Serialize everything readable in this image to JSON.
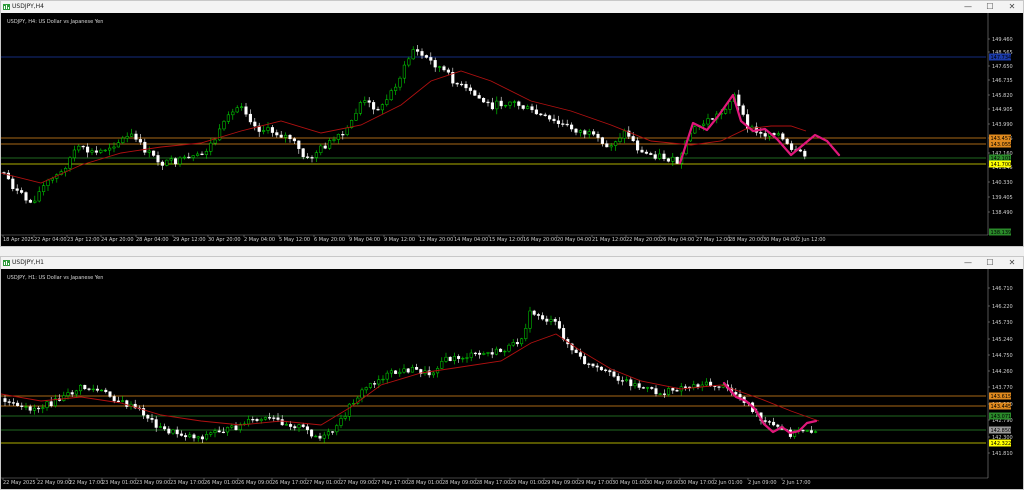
{
  "windows": [
    {
      "title": "USDJPY,H4",
      "chart_label": "USDJPY, H4:  US Dollar vs Japanese Yen",
      "price_labels": [
        "149.460",
        "148.565",
        "147.650",
        "146.735",
        "145.820",
        "144.905",
        "143.990",
        "143.075",
        "142.160",
        "141.245",
        "140.330",
        "139.405",
        "138.490"
      ],
      "time_labels": [
        "18 Apr 2025",
        "22 Apr 04:00",
        "23 Apr 12:00",
        "24 Apr 20:00",
        "28 Apr 04:00",
        "29 Apr 12:00",
        "30 Apr 20:00",
        "2 May 04:00",
        "5 May 12:00",
        "6 May 20:00",
        "9 May 04:00",
        "9 May 12:00",
        "12 May 20:00",
        "14 May 04:00",
        "15 May 12:00",
        "16 May 20:00",
        "20 May 04:00",
        "21 May 12:00",
        "22 May 20:00",
        "26 May 04:00",
        "27 May 12:00",
        "28 May 20:00",
        "30 May 04:00",
        "2 Jun 12:00"
      ],
      "badges": [
        {
          "text": "147.734",
          "color": "#1a3aa8"
        },
        {
          "text": "143.457",
          "color": "#e08a1e"
        },
        {
          "text": "143.055",
          "color": "#e08a1e"
        },
        {
          "text": "142.101",
          "color": "#2a8a2a"
        },
        {
          "text": "141.700",
          "color": "#ffff00"
        },
        {
          "text": "138.139",
          "color": "#2a8a2a"
        }
      ]
    },
    {
      "title": "USDJPY,H1",
      "chart_label": "USDJPY, H1:  US Dollar vs Japanese Yen",
      "price_labels": [
        "146.710",
        "146.220",
        "145.730",
        "145.240",
        "144.750",
        "144.260",
        "143.770",
        "143.280",
        "142.790",
        "142.300",
        "141.810"
      ],
      "time_labels": [
        "22 May 2025",
        "22 May 09:00",
        "22 May 17:00",
        "23 May 01:00",
        "23 May 09:00",
        "23 May 17:00",
        "26 May 01:00",
        "26 May 09:00",
        "26 May 17:00",
        "27 May 01:00",
        "27 May 09:00",
        "27 May 17:00",
        "28 May 01:00",
        "28 May 09:00",
        "28 May 17:00",
        "29 May 01:00",
        "29 May 09:00",
        "29 May 17:00",
        "30 May 01:00",
        "30 May 09:00",
        "30 May 17:00",
        "2 Jun 01:00",
        "2 Jun 09:00",
        "2 Jun 17:00"
      ],
      "badges": [
        {
          "text": "143.615",
          "color": "#e08a1e"
        },
        {
          "text": "143.445",
          "color": "#e08a1e"
        },
        {
          "text": "143.071",
          "color": "#2a8a2a"
        },
        {
          "text": "142.850",
          "color": "#9a9a9a"
        },
        {
          "text": "142.322",
          "color": "#ffff00"
        }
      ]
    }
  ],
  "window_buttons": {
    "minimize": "—",
    "maximize": "☐",
    "close": "✕"
  },
  "colors": {
    "bull": "#00e000",
    "bear": "#ffffff",
    "ma": "#b01010",
    "pattern": "#e0177a",
    "blue_line": "#1a3aa8",
    "orange_line": "#e08a1e",
    "green_line": "#2a8a2a",
    "yellow_line": "#e8e800"
  }
}
